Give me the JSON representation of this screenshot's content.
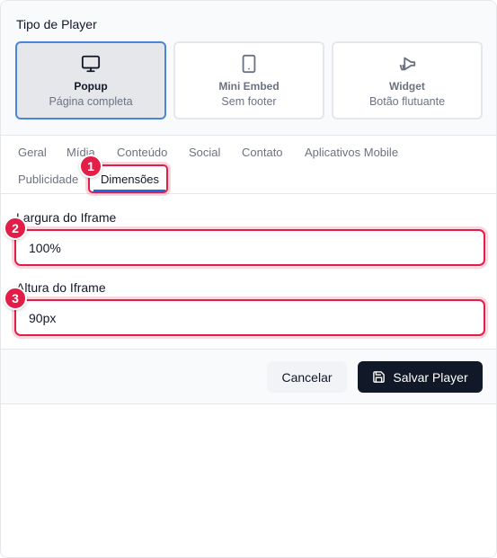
{
  "player_type": {
    "title": "Tipo de Player",
    "options": [
      {
        "name": "Popup",
        "desc": "Página completa",
        "icon": "monitor-icon",
        "active": true
      },
      {
        "name": "Mini Embed",
        "desc": "Sem footer",
        "icon": "tablet-icon",
        "active": false
      },
      {
        "name": "Widget",
        "desc": "Botão flutuante",
        "icon": "megaphone-icon",
        "active": false
      }
    ]
  },
  "tabs": [
    "Geral",
    "Mídia",
    "Conteúdo",
    "Social",
    "Contato",
    "Aplicativos Mobile",
    "Publicidade",
    "Dimensões"
  ],
  "active_tab": "Dimensões",
  "annotations": [
    "1",
    "2",
    "3"
  ],
  "fields": {
    "width": {
      "label": "Largura do Iframe",
      "value": "100%"
    },
    "height": {
      "label": "Altura do Iframe",
      "value": "90px"
    }
  },
  "footer": {
    "cancel_label": "Cancelar",
    "save_label": "Salvar Player"
  },
  "colors": {
    "accent": "#4a86d8",
    "highlight": "#e11d48",
    "primary_button": "#111827"
  }
}
